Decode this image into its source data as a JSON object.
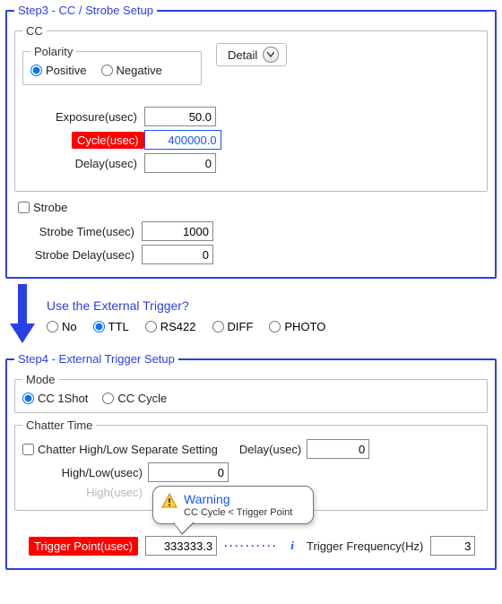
{
  "step3": {
    "title": "Step3 - CC / Strobe Setup",
    "cc": {
      "title": "CC",
      "polarity": {
        "title": "Polarity",
        "positive": "Positive",
        "negative": "Negative",
        "selected": "Positive"
      },
      "detail": {
        "label": "Detail"
      },
      "exposure": {
        "label": "Exposure(usec)",
        "value": "50.0"
      },
      "cycle": {
        "label": "Cycle(usec)",
        "value": "400000.0"
      },
      "delay": {
        "label": "Delay(usec)",
        "value": "0"
      }
    },
    "strobe": {
      "checkbox": "Strobe",
      "checked": false,
      "time": {
        "label": "Strobe Time(usec)",
        "value": "1000"
      },
      "delay": {
        "label": "Strobe Delay(usec)",
        "value": "0"
      }
    }
  },
  "ext_trigger_q": {
    "question": "Use the External Trigger?",
    "options": {
      "no": "No",
      "ttl": "TTL",
      "rs422": "RS422",
      "diff": "DIFF",
      "photo": "PHOTO"
    },
    "selected": "TTL"
  },
  "step4": {
    "title": "Step4 - External Trigger Setup",
    "mode": {
      "title": "Mode",
      "cc1shot": "CC 1Shot",
      "cccycle": "CC Cycle",
      "selected": "CC 1Shot"
    },
    "chatter": {
      "title": "Chatter Time",
      "separate_cb": "Chatter High/Low Separate Setting",
      "separate_checked": false,
      "highlow": {
        "label": "High/Low(usec)",
        "value": "0"
      },
      "high_disabled": {
        "label": "High(usec)"
      },
      "delay": {
        "label": "Delay(usec)",
        "value": "0"
      }
    },
    "trigger": {
      "point_label": "Trigger Point(usec)",
      "point_value": "333333.3",
      "freq_label": "Trigger Frequency(Hz)",
      "freq_value": "3"
    },
    "tooltip": {
      "title": "Warning",
      "message": "CC Cycle < Trigger Point"
    }
  }
}
